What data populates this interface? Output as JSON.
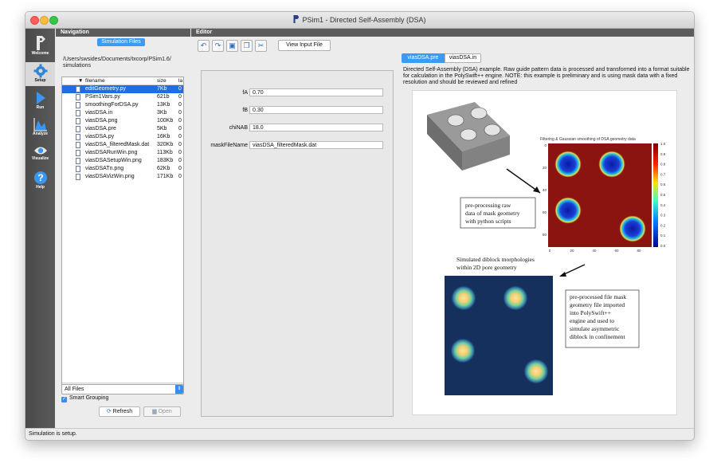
{
  "window": {
    "title": "PSim1 - Directed Self-Assembly (DSA)"
  },
  "sidebar": {
    "items": [
      {
        "label": "Welcome",
        "icon": "app-logo-icon"
      },
      {
        "label": "Setup",
        "icon": "gear-icon"
      },
      {
        "label": "Run",
        "icon": "play-icon"
      },
      {
        "label": "Analyze",
        "icon": "chart-icon"
      },
      {
        "label": "Visualize",
        "icon": "eye-icon"
      },
      {
        "label": "Help",
        "icon": "help-icon"
      }
    ]
  },
  "navigation": {
    "header": "Navigation",
    "sim_files_button": "Simulation Files",
    "path": "/Users/swsides/Documents/txcorp/PSim1.6/\nsimulations",
    "columns": {
      "sort": "▼",
      "filename": "filename",
      "size": "size",
      "extra": "la"
    },
    "files": [
      {
        "name": "editGeometry.py",
        "size": "7Kb",
        "x": "0"
      },
      {
        "name": "PSim1Vars.py",
        "size": "621b",
        "x": "0"
      },
      {
        "name": "smoothingForDSA.py",
        "size": "13Kb",
        "x": "0"
      },
      {
        "name": "viasDSA.in",
        "size": "3Kb",
        "x": "0"
      },
      {
        "name": "viasDSA.png",
        "size": "100Kb",
        "x": "0"
      },
      {
        "name": "viasDSA.pre",
        "size": "5Kb",
        "x": "0"
      },
      {
        "name": "viasDSA.py",
        "size": "16Kb",
        "x": "0"
      },
      {
        "name": "viasDSA_filteredMask.dat",
        "size": "320Kb",
        "x": "0"
      },
      {
        "name": "viasDSARunWin.png",
        "size": "113Kb",
        "x": "0"
      },
      {
        "name": "viasDSASetupWin.png",
        "size": "183Kb",
        "x": "0"
      },
      {
        "name": "viasDSATn.png",
        "size": "62Kb",
        "x": "0"
      },
      {
        "name": "viasDSAVizWin.png",
        "size": "171Kb",
        "x": "0"
      }
    ],
    "selected_index": 0,
    "filter_value": "All Files",
    "smart_grouping_label": "Smart Grouping",
    "smart_grouping_checked": true,
    "refresh_label": "Refresh",
    "open_label": "Open"
  },
  "editor": {
    "header": "Editor",
    "view_input_button": "View Input File",
    "tabs": [
      {
        "label": "viasDSA.pre",
        "active": true
      },
      {
        "label": "viasDSA.in",
        "active": false
      }
    ],
    "fields": [
      {
        "label": "fA",
        "value": "0.70"
      },
      {
        "label": "fB",
        "value": "0.30"
      },
      {
        "label": "chiNAB",
        "value": "18.0"
      },
      {
        "label": "maskFileName",
        "value": "viasDSA_filteredMask.dat"
      }
    ],
    "description": "Directed Self-Assembly (DSA) example. Raw guide pattern data is processed and transformed into a format suitable for calculation in the PolySwift++ engine. NOTE: this example is preliminary and is using mask data with a fixed resolution and should be reviewed and refined"
  },
  "figure": {
    "heatmap_title": "Filtering & Gaussian smoothing of DSA geometry data",
    "annotation_1": [
      "pre-processing raw",
      "data of mask geometry",
      "with python scripts"
    ],
    "annotation_2": [
      "Simulated diblock morphologies",
      "within 2D pore geometry"
    ],
    "annotation_3": [
      "pre-processed file mask",
      "geometry file imported",
      "into PolySwift++",
      "engine and used to",
      "simulate asymmetric",
      "diblock in confinement"
    ],
    "colorbar_ticks": [
      "1.0",
      "0.9",
      "0.8",
      "0.7",
      "0.6",
      "0.5",
      "0.4",
      "0.3",
      "0.2",
      "0.1",
      "0.0"
    ],
    "heatmap_x_ticks": [
      "0",
      "20",
      "40",
      "60",
      "80"
    ],
    "heatmap_y_ticks": [
      "0",
      "20",
      "40",
      "60",
      "80"
    ],
    "colors": {
      "background_red": "#8b1410",
      "well_blue": "#1434b4",
      "sim_background": "#15305c"
    }
  },
  "status": {
    "text": "Simulation is setup."
  }
}
